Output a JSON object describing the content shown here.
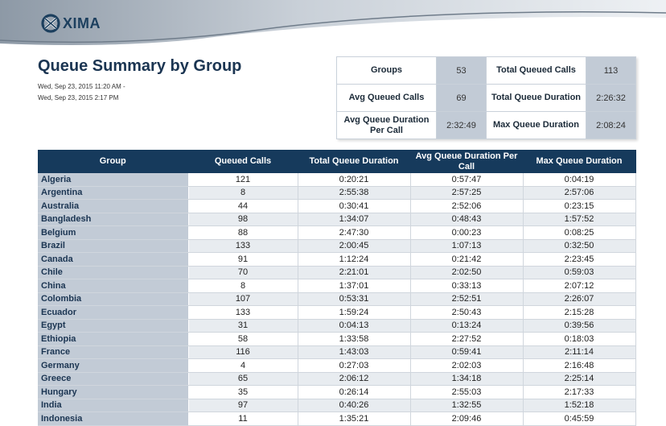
{
  "brand": {
    "logo_text": "XIMA"
  },
  "report": {
    "title": "Queue Summary by Group",
    "date_from": "Wed, Sep 23, 2015 11:20 AM -",
    "date_to": "Wed, Sep 23, 2015 2:17 PM"
  },
  "summary": {
    "groups_label": "Groups",
    "groups_value": "53",
    "total_queued_calls_label": "Total Queued Calls",
    "total_queued_calls_value": "113",
    "avg_queued_calls_label": "Avg Queued Calls",
    "avg_queued_calls_value": "69",
    "total_queue_duration_label": "Total Queue Duration",
    "total_queue_duration_value": "2:26:32",
    "avg_queue_duration_label": "Avg Queue Duration Per Call",
    "avg_queue_duration_value": "2:32:49",
    "max_queue_duration_label": "Max Queue Duration",
    "max_queue_duration_value": "2:08:24"
  },
  "table": {
    "headers": [
      "Group",
      "Queued Calls",
      "Total Queue Duration",
      "Avg Queue Duration Per Call",
      "Max Queue Duration"
    ],
    "rows": [
      [
        "Algeria",
        "121",
        "0:20:21",
        "0:57:47",
        "0:04:19"
      ],
      [
        "Argentina",
        "8",
        "2:55:38",
        "2:57:25",
        "2:57:06"
      ],
      [
        "Australia",
        "44",
        "0:30:41",
        "2:52:06",
        "0:23:15"
      ],
      [
        "Bangladesh",
        "98",
        "1:34:07",
        "0:48:43",
        "1:57:52"
      ],
      [
        "Belgium",
        "88",
        "2:47:30",
        "0:00:23",
        "0:08:25"
      ],
      [
        "Brazil",
        "133",
        "2:00:45",
        "1:07:13",
        "0:32:50"
      ],
      [
        "Canada",
        "91",
        "1:12:24",
        "0:21:42",
        "2:23:45"
      ],
      [
        "Chile",
        "70",
        "2:21:01",
        "2:02:50",
        "0:59:03"
      ],
      [
        "China",
        "8",
        "1:37:01",
        "0:33:13",
        "2:07:12"
      ],
      [
        "Colombia",
        "107",
        "0:53:31",
        "2:52:51",
        "2:26:07"
      ],
      [
        "Ecuador",
        "133",
        "1:59:24",
        "2:50:43",
        "2:15:28"
      ],
      [
        "Egypt",
        "31",
        "0:04:13",
        "0:13:24",
        "0:39:56"
      ],
      [
        "Ethiopia",
        "58",
        "1:33:58",
        "2:27:52",
        "0:18:03"
      ],
      [
        "France",
        "116",
        "1:43:03",
        "0:59:41",
        "2:11:14"
      ],
      [
        "Germany",
        "4",
        "0:27:03",
        "2:02:03",
        "2:16:48"
      ],
      [
        "Greece",
        "65",
        "2:06:12",
        "1:34:18",
        "2:25:14"
      ],
      [
        "Hungary",
        "35",
        "0:26:14",
        "2:55:03",
        "2:17:33"
      ],
      [
        "India",
        "97",
        "0:40:26",
        "1:32:55",
        "1:52:18"
      ],
      [
        "Indonesia",
        "11",
        "1:35:21",
        "2:09:46",
        "0:45:59"
      ]
    ]
  },
  "colors": {
    "header_bg": "#163a5c",
    "group_col_bg": "#c2cbd6",
    "alt_row_bg": "#e8ecf0"
  },
  "icons": {
    "logo": "xima-logo-icon"
  }
}
